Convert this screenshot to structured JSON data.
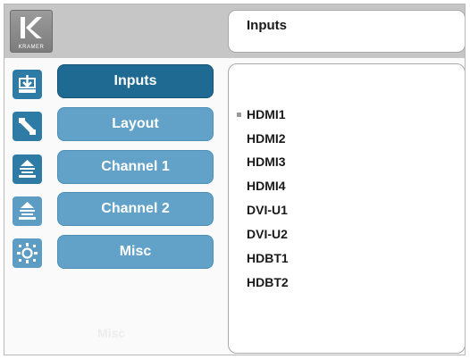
{
  "header": {
    "logo_text": "KRAMER",
    "title": "Inputs"
  },
  "nav": {
    "items": [
      {
        "label": "Inputs",
        "icon": "input-arrow-icon",
        "active": true
      },
      {
        "label": "Layout",
        "icon": "layout-diagonal-icon",
        "active": false
      },
      {
        "label": "Channel 1",
        "icon": "channel-1-icon",
        "active": false
      },
      {
        "label": "Channel 2",
        "icon": "channel-2-icon",
        "active": false
      },
      {
        "label": "Misc",
        "icon": "misc-settings-icon",
        "active": false
      }
    ],
    "faded_label": "Misc"
  },
  "inputs_list": {
    "selected_index": 0,
    "items": [
      "HDMI1",
      "HDMI2",
      "HDMI3",
      "HDMI4",
      "DVI-U1",
      "DVI-U2",
      "HDBT1",
      "HDBT2"
    ]
  },
  "colors": {
    "nav_active": "#1f6a92",
    "nav_inactive": "#62a2c9",
    "top_bar": "#c6c6c6"
  }
}
